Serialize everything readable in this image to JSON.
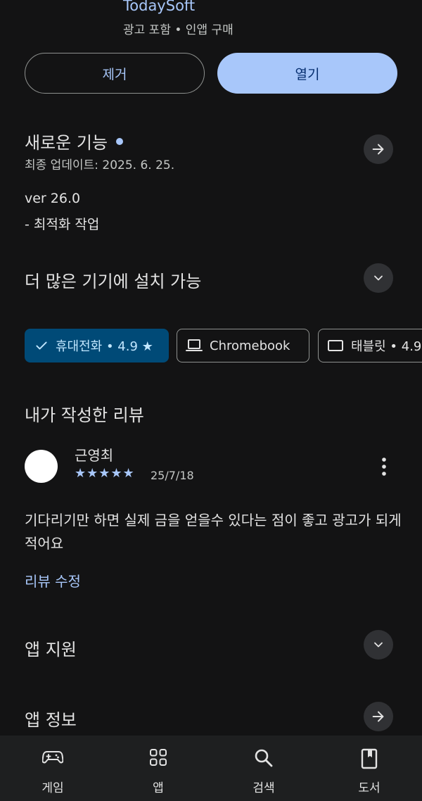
{
  "app": {
    "developer": "TodaySoft",
    "meta": "광고 포함 • 인앱 구매"
  },
  "actions": {
    "remove_label": "제거",
    "open_label": "열기"
  },
  "whats_new": {
    "title": "새로운 기능",
    "updated": "최종 업데이트: 2025. 6. 25.",
    "version": "ver 26.0",
    "note": "- 최적화 작업"
  },
  "devices": {
    "title": "더 많은 기기에 설치 가능",
    "chips": [
      {
        "label": "휴대전화 • 4.9 ★",
        "selected": true,
        "icon": "check-icon"
      },
      {
        "label": "Chromebook",
        "selected": false,
        "icon": "laptop-icon"
      },
      {
        "label": "태블릿 • 4.9",
        "selected": false,
        "icon": "tablet-icon"
      }
    ]
  },
  "my_review": {
    "title": "내가 작성한 리뷰",
    "reviewer": "근영최",
    "stars": "★★★★★",
    "rating": 5,
    "date": "25/7/18",
    "text": "기다리기만 하면 실제 금을 얻을수 있다는 점이 좋고 광고가 되게 적어요",
    "edit_label": "리뷰 수정"
  },
  "app_support": {
    "title": "앱 지원"
  },
  "app_info": {
    "title": "앱 정보"
  },
  "bottom_nav": [
    {
      "label": "게임",
      "icon": "gamepad-icon"
    },
    {
      "label": "앱",
      "icon": "apps-grid-icon"
    },
    {
      "label": "검색",
      "icon": "search-icon"
    },
    {
      "label": "도서",
      "icon": "book-icon"
    }
  ],
  "colors": {
    "background": "#131314",
    "accent": "#a8c7fa",
    "selected_chip": "#004a77",
    "nav_background": "#1e1f20"
  }
}
